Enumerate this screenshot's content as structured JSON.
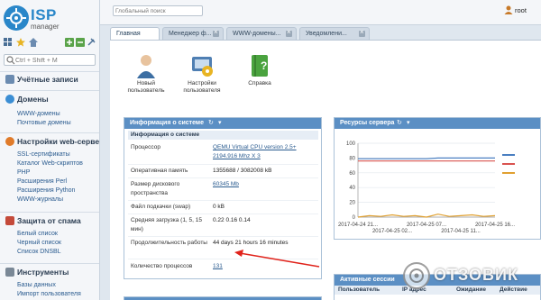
{
  "app": {
    "logo_title": "ISP",
    "logo_subtitle": "manager",
    "brand_color": "#2a87c9"
  },
  "sidebar": {
    "search_placeholder": "Ctrl + Shift + M",
    "toolbar_icons": [
      "grid-icon",
      "star-icon",
      "home-icon",
      "plus-icon",
      "minus-icon",
      "pin-icon"
    ],
    "sections": [
      {
        "title": "Учётные записи",
        "icon": "users-icon",
        "links": []
      },
      {
        "title": "Домены",
        "icon": "globe-icon",
        "links": [
          "WWW-домены",
          "Почтовые домены"
        ]
      },
      {
        "title": "Настройки web-сервера",
        "icon": "gear-icon",
        "links": [
          "SSL-сертификаты",
          "Каталог Web-скриптов",
          "PHP",
          "Расширения Perl",
          "Расширения Python",
          "WWW-журналы"
        ]
      },
      {
        "title": "Защита от спама",
        "icon": "shield-icon",
        "links": [
          "Белый список",
          "Черный список",
          "Список DNSBL"
        ]
      },
      {
        "title": "Инструменты",
        "icon": "tools-icon",
        "links": [
          "Базы данных",
          "Импорт пользователя"
        ]
      }
    ]
  },
  "header": {
    "global_search_placeholder": "Глобальный поиск",
    "user_name": "root"
  },
  "tabs": [
    {
      "label": "Главная",
      "active": true,
      "closable": false
    },
    {
      "label": "Менеджер ф...",
      "active": false,
      "closable": true
    },
    {
      "label": "WWW-домены...",
      "active": false,
      "closable": true
    },
    {
      "label": "Уведомлени...",
      "active": false,
      "closable": true
    }
  ],
  "quick_icons": [
    {
      "label": "Новый пользователь",
      "icon": "new-user-icon"
    },
    {
      "label": "Настройки пользователя",
      "icon": "user-settings-icon"
    },
    {
      "label": "Справка",
      "icon": "help-book-icon"
    }
  ],
  "system_info": {
    "title": "Информация о системе",
    "subheader": "Информация о системе",
    "rows": [
      {
        "key": "Процессор",
        "value": "QEMU Virtual CPU version 2.5+",
        "value2": "2194.916 Mhz X 3",
        "link": true
      },
      {
        "key": "Оперативная память",
        "value": "1355688 / 3082008 kB",
        "link": false
      },
      {
        "key": "Размер дискового пространства",
        "value": "60345 Mb",
        "link": true
      },
      {
        "key": "Файл подкачки (swap)",
        "value": "0 kB",
        "link": false
      },
      {
        "key": "Средняя загрузка (1, 5, 15 мин)",
        "value": "0.22 0.16 0.14",
        "link": false
      },
      {
        "key": "Продолжительность работы",
        "value": "44 days 21 hours 16 minutes",
        "link": false
      },
      {
        "key": "Количество процессов",
        "value": "131",
        "link": true
      }
    ]
  },
  "server_resources": {
    "title": "Ресурсы сервера"
  },
  "chart_data": {
    "type": "line",
    "x": [
      "2017-04-24 21...",
      "2017-04-25 02...",
      "2017-04-25 07...",
      "2017-04-25 11...",
      "2017-04-25 16..."
    ],
    "ylim": [
      0,
      100
    ],
    "yticks": [
      0,
      20,
      40,
      60,
      80,
      100
    ],
    "grid": true,
    "legend_position": "right",
    "series": [
      {
        "color": "#4a7fc1",
        "values": [
          79,
          79,
          79,
          79,
          79,
          79,
          79,
          80,
          80,
          80,
          80,
          80,
          80
        ]
      },
      {
        "color": "#d9534f",
        "values": [
          76,
          76,
          76,
          76,
          76,
          76,
          76,
          76,
          76,
          76,
          76,
          76,
          76
        ]
      },
      {
        "color": "#e0a030",
        "values": [
          0,
          2,
          1,
          3,
          1,
          2,
          0,
          4,
          1,
          2,
          3,
          1,
          2
        ]
      }
    ]
  },
  "sessions": {
    "title": "Активные сессии",
    "columns": [
      "Пользователь",
      "IP адрес",
      "Ожидание",
      "Действие"
    ]
  },
  "watermark": {
    "text": "ОТЗОВИК"
  }
}
